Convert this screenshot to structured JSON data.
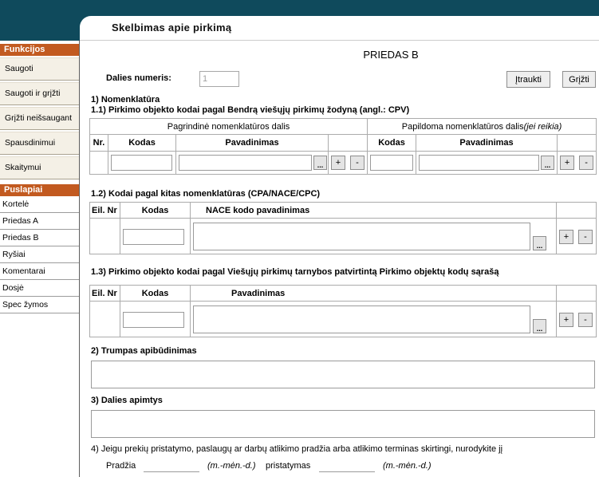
{
  "colors": {
    "header_bg": "#0f4a5c",
    "sidebar_heading_bg": "#c25a20",
    "sidebar_action_bg": "#f4f0e6"
  },
  "header": {
    "title": "Skelbimas apie pirkimą"
  },
  "sidebar": {
    "functions_heading": "Funkcijos",
    "functions": [
      "Saugoti",
      "Saugoti ir grįžti",
      "Grįžti neišsaugant",
      "Spausdinimui",
      "Skaitymui"
    ],
    "pages_heading": "Puslapiai",
    "pages": [
      "Kortelė",
      "Priedas A",
      "Priedas B",
      "Ryšiai",
      "Komentarai",
      "Dosjė",
      "Spec žymos"
    ]
  },
  "form": {
    "heading": "PRIEDAS B",
    "part_number_label": "Dalies numeris:",
    "part_number_value": "1",
    "include_button": "Įtraukti",
    "back_button": "Grįžti"
  },
  "nomenclature": {
    "heading": "1) Nomenklatūra",
    "cpv": {
      "heading": "1.1) Pirkimo objekto kodai pagal Bendrą viešųjų pirkimų žodyną (angl.: CPV)",
      "main_group": "Pagrindinė nomenklatūros dalis",
      "extra_group": "Papildoma nomenklatūros dalis",
      "extra_group_note": "(jei reikia)",
      "col_nr": "Nr.",
      "col_code": "Kodas",
      "col_name": "Pavadinimas",
      "col_extra_code": "Kodas",
      "col_extra_name": "Pavadinimas"
    },
    "other": {
      "heading": "1.2) Kodai pagal kitas nomenklatūras (CPA/NACE/CPC)",
      "col_nr": "Eil. Nr",
      "col_code": "Kodas",
      "col_name": "NACE kodo pavadinimas"
    },
    "vpt": {
      "heading": "1.3) Pirkimo objekto kodai pagal Viešųjų pirkimų tarnybos patvirtintą Pirkimo objektų kodų sąrašą",
      "col_nr": "Eil. Nr",
      "col_code": "Kodas",
      "col_name": "Pavadinimas"
    }
  },
  "row_buttons": {
    "browse": "...",
    "add": "+",
    "remove": "-"
  },
  "description": {
    "heading": "2) Trumpas apibūdinimas"
  },
  "scope": {
    "heading": "3) Dalies apimtys"
  },
  "schedule": {
    "heading": "4) Jeigu prekių pristatymo, paslaugų ar darbų atlikimo pradžia arba atlikimo terminas skirtingi, nurodykite jį",
    "start_label": "Pradžia",
    "start_hint": "(m.-mėn.-d.)",
    "delivery_label": "pristatymas",
    "delivery_hint": "(m.-mėn.-d.)"
  }
}
